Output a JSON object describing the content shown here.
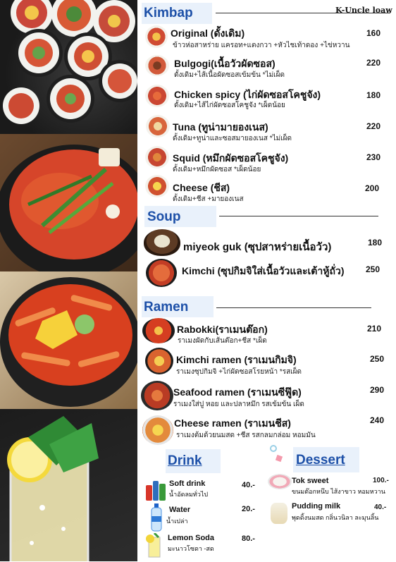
{
  "brand": "K-Uncle loaw",
  "sections": {
    "kimbap": "Kimbap",
    "soup": "Soup",
    "ramen": "Ramen",
    "drink": "Drink",
    "dessert": "Dessert"
  },
  "kimbap": [
    {
      "name": "Original (ดั้งเดิม)",
      "desc": "ข้าวห่อสาหร่าย แครอท+แตงกวา +หัวไชเท้าดอง +ไข่หวาน",
      "price": "160"
    },
    {
      "name": "Bulgogi(เนื้อวัวผัดซอส)",
      "desc": "ดั้งเดิม+ไส้เนื้อผัดซอสเข้มข้น *ไม่เผ็ด",
      "price": "220"
    },
    {
      "name": "Chicken spicy (ไก่ผัดซอสโคชูจัง)",
      "desc": "ดั้งเดิม+ไส้ไก่ผัดซอสโคชูจัง *เผ็ดน้อย",
      "price": "180"
    },
    {
      "name": "Tuna (ทูน่ามายองเนส)",
      "desc": "ดั้งเดิม+ทูน่าและซอสมายองเนส *ไม่เผ็ด",
      "price": "220"
    },
    {
      "name": "Squid (หมึกผัดซอสโคชูจัง)",
      "desc": "ดั้งเดิม+หมึกผัดซอส *เผ็ดน้อย",
      "price": "230"
    },
    {
      "name": "Cheese (ชีส)",
      "desc": "ดั้งเดิม+ชีส +มายองเนส",
      "price": "200"
    }
  ],
  "soup": [
    {
      "name": "miyeok guk (ซุปสาหร่ายเนื้อวัว)",
      "price": "180"
    },
    {
      "name": "Kimchi (ซุปกิมจิใส่เนื้อวัวและเต้าหู้ถั่ว)",
      "price": "250"
    }
  ],
  "ramen": [
    {
      "name": "Rabokki(ราเมนต๊อก)",
      "desc": "ราเมงผัดกับเส้นต๊อก+ชีส *เผ็ด",
      "price": "210"
    },
    {
      "name": "Kimchi ramen (ราเมนกิมจิ)",
      "desc": "ราเมงซุปกิมจิ +ไก่ผัดซอสโรยหน้า *รสเผ็ด",
      "price": "250"
    },
    {
      "name": "Seafood ramen (ราเมนซีฟู๊ด)",
      "desc": "ราเมงใส่ปู หอย และปลาหมึก รสเข้มข้น เผ็ด",
      "price": "290"
    },
    {
      "name": "Cheese ramen (ราเมนชีส)",
      "desc": "ราเมงต้มด้วยนมสด +ชีส รสกลมกล่อม หอมมัน",
      "price": "240"
    }
  ],
  "drinks": [
    {
      "name": "Soft drink",
      "desc": "น้ำอัดลมทั่วไป",
      "price": "40.-"
    },
    {
      "name": "Water",
      "desc": "น้ำเปล่า",
      "price": "20.-"
    },
    {
      "name": "Lemon Soda",
      "desc": "มะนาวโซดา -สด",
      "price": "80.-"
    }
  ],
  "desserts": [
    {
      "name": "Tok sweet",
      "desc": "ขนมต๊อกหนึบ ไส้งาขาว หอมหวาน",
      "price": "100.-"
    },
    {
      "name": "Pudding milk",
      "desc": "พุดดิ้งนมสด กลิ่นวนิลา ละมุนลิ้น",
      "price": "40.-"
    }
  ],
  "colors": {
    "section_title": "#1d50a8",
    "section_bg": "#e9f1fb"
  }
}
